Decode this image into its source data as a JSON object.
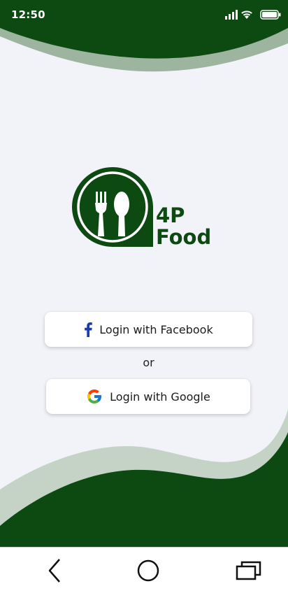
{
  "status_bar": {
    "time": "12:50"
  },
  "logo": {
    "line1": "4P",
    "line2": "Food"
  },
  "buttons": {
    "facebook_label": "Login with Facebook",
    "google_label": "Login with Google"
  },
  "separator": "or",
  "colors": {
    "brand_green": "#0c4a12",
    "wave_light": "#c5d3c6",
    "background": "#f2f3f9",
    "facebook_blue": "#1a3bb5"
  },
  "icons": {
    "facebook": "facebook-icon",
    "google": "google-icon",
    "nav_back": "back-icon",
    "nav_home": "home-icon",
    "nav_recent": "recent-apps-icon"
  }
}
